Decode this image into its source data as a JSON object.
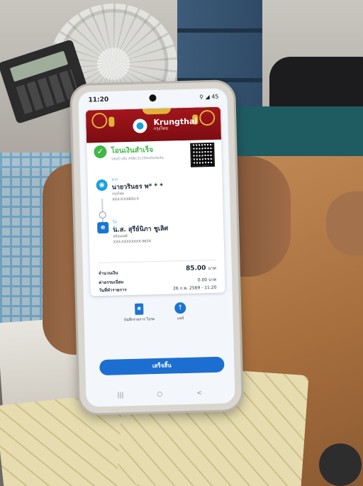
{
  "status": {
    "time": "11:20",
    "indicators": "⚲ ◢ 45"
  },
  "bank": {
    "name": "Krungthai",
    "name_th": "กรุงไทย"
  },
  "receipt": {
    "title": "โอนเงินสำเร็จ",
    "reference": "รหัสอ้างอิง A98c3c594a9a4a4a",
    "sender": {
      "tag": "จาก",
      "name": "นายวรินธร พ* * *",
      "bank": "กรุงไทย",
      "account": "XXX-X-XX893-5"
    },
    "receiver": {
      "tag": "ไปยัง",
      "name": "น.ส. สุรีย์นิภา ชูเลิศ",
      "bank": "พร้อมเพย์",
      "account": "XXX-XXXXXXXX-9654"
    },
    "amount_label": "จำนวนเงิน",
    "amount_value": "85.00",
    "amount_unit": "บาท",
    "fee_label": "ค่าธรรมเนียม",
    "fee_value": "0.00 บาท",
    "date_label": "วันที่ทำรายการ",
    "date_value": "26 ก.พ. 2569 - 11:20"
  },
  "actions": {
    "save_label": "บันทึกรายการ โปรด",
    "share_label": "แชร์"
  },
  "done_label": "เสร็จสิ้น",
  "nav": {
    "recent": "|||",
    "home": "○",
    "back": "<"
  },
  "colors": {
    "success": "#43b649",
    "primary": "#1c6fd1",
    "banner": "#a3161c",
    "brand_blue": "#1ba0dc"
  }
}
